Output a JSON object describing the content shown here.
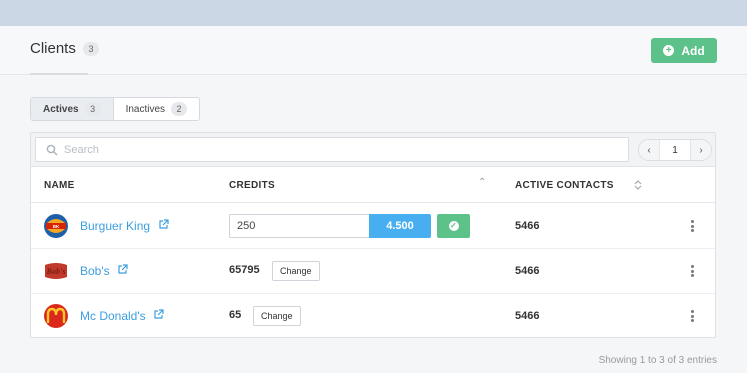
{
  "header": {
    "title": "Clients",
    "count": "3",
    "add_label": "Add"
  },
  "tabs": [
    {
      "label": "Actives",
      "count": "3",
      "active": true
    },
    {
      "label": "Inactives",
      "count": "2",
      "active": false
    }
  ],
  "search": {
    "placeholder": "Search",
    "value": ""
  },
  "pager": {
    "prev_icon": "chevron-left-icon",
    "page": "1",
    "next_icon": "chevron-right-icon"
  },
  "table": {
    "columns": {
      "name": "NAME",
      "credits": "CREDITS",
      "active_contacts": "ACTIVE CONTACTS"
    },
    "rows": [
      {
        "name": "Burguer King",
        "credits_input": "250",
        "credits_total": "4.500",
        "active_contacts": "5466",
        "logo": "burger-king-logo"
      },
      {
        "name": "Bob's",
        "credits": "65795",
        "change_label": "Change",
        "active_contacts": "5466",
        "logo": "bobs-logo"
      },
      {
        "name": "Mc Donald's",
        "credits": "65",
        "change_label": "Change",
        "active_contacts": "5466",
        "logo": "mcdonalds-logo"
      }
    ]
  },
  "footer": {
    "info": "Showing 1 to 3 of 3 entries"
  },
  "colors": {
    "accent_green": "#5cc28a",
    "accent_blue": "#47aff0",
    "link_blue": "#3d9fe0",
    "topbar": "#ccd7e6"
  }
}
